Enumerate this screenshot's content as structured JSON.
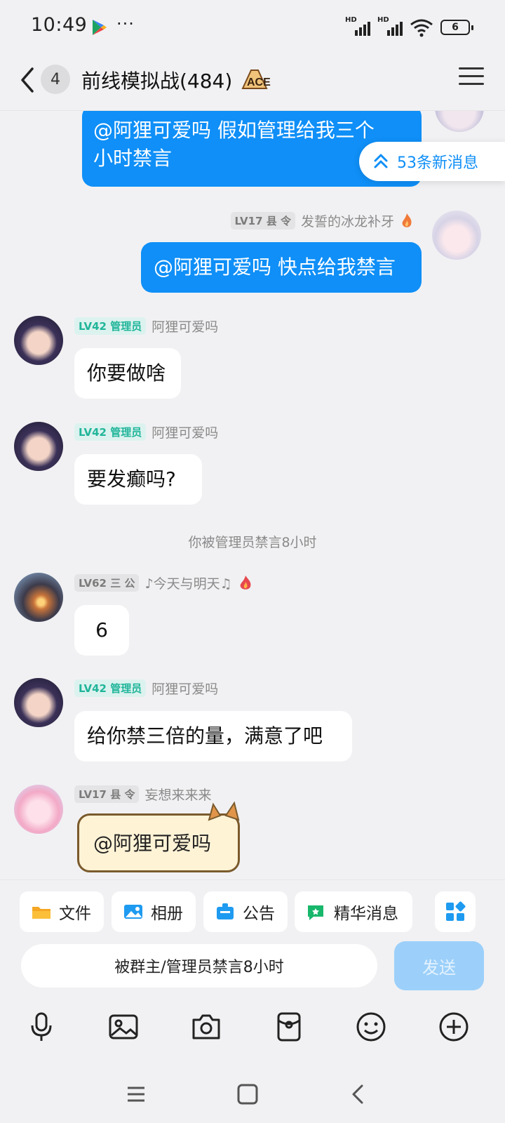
{
  "status_bar": {
    "time": "10:49",
    "dots": "···",
    "signal1_label": "HD",
    "signal2_label": "HD",
    "battery": "6"
  },
  "header": {
    "unread_count": "4",
    "title": "前线模拟战(484)",
    "badge_icon": "ace-badge-icon",
    "menu_icon": "menu-icon"
  },
  "new_messages_button": {
    "label": "53条新消息"
  },
  "messages": [
    {
      "side": "me",
      "text": "@阿狸可爱吗 假如管理给我三个小时禁言",
      "line1": "@阿狸可爱吗 假如管理给我三个",
      "line2": "小时禁言"
    },
    {
      "side": "me",
      "level": "LV17",
      "title": "县 令",
      "name": "发誓的冰龙补牙",
      "text": "@阿狸可爱吗 快点给我禁言"
    },
    {
      "side": "other",
      "level": "LV42",
      "title": "管理员",
      "name": "阿狸可爱吗",
      "text": "你要做啥"
    },
    {
      "side": "other",
      "level": "LV42",
      "title": "管理员",
      "name": "阿狸可爱吗",
      "text": "要发癫吗?"
    },
    {
      "side": "other",
      "level": "LV62",
      "title": "三 公",
      "name": "♪今天与明天♫",
      "text": "6"
    },
    {
      "side": "other",
      "level": "LV42",
      "title": "管理员",
      "name": "阿狸可爱吗",
      "text": "给你禁三倍的量，满意了吧"
    },
    {
      "side": "other",
      "level": "LV17",
      "title": "县 令",
      "name": "妄想来来来",
      "text": "@阿狸可爱吗"
    }
  ],
  "system_message": "你被管理员禁言8小时",
  "tools": [
    "文件",
    "相册",
    "公告",
    "精华消息"
  ],
  "input": {
    "muted_text": "被群主/管理员禁言8小时",
    "send_label": "发送"
  },
  "colors": {
    "accent": "#0f8ff7",
    "admin_badge": "#20b59a",
    "background": "#f1f1f3"
  }
}
